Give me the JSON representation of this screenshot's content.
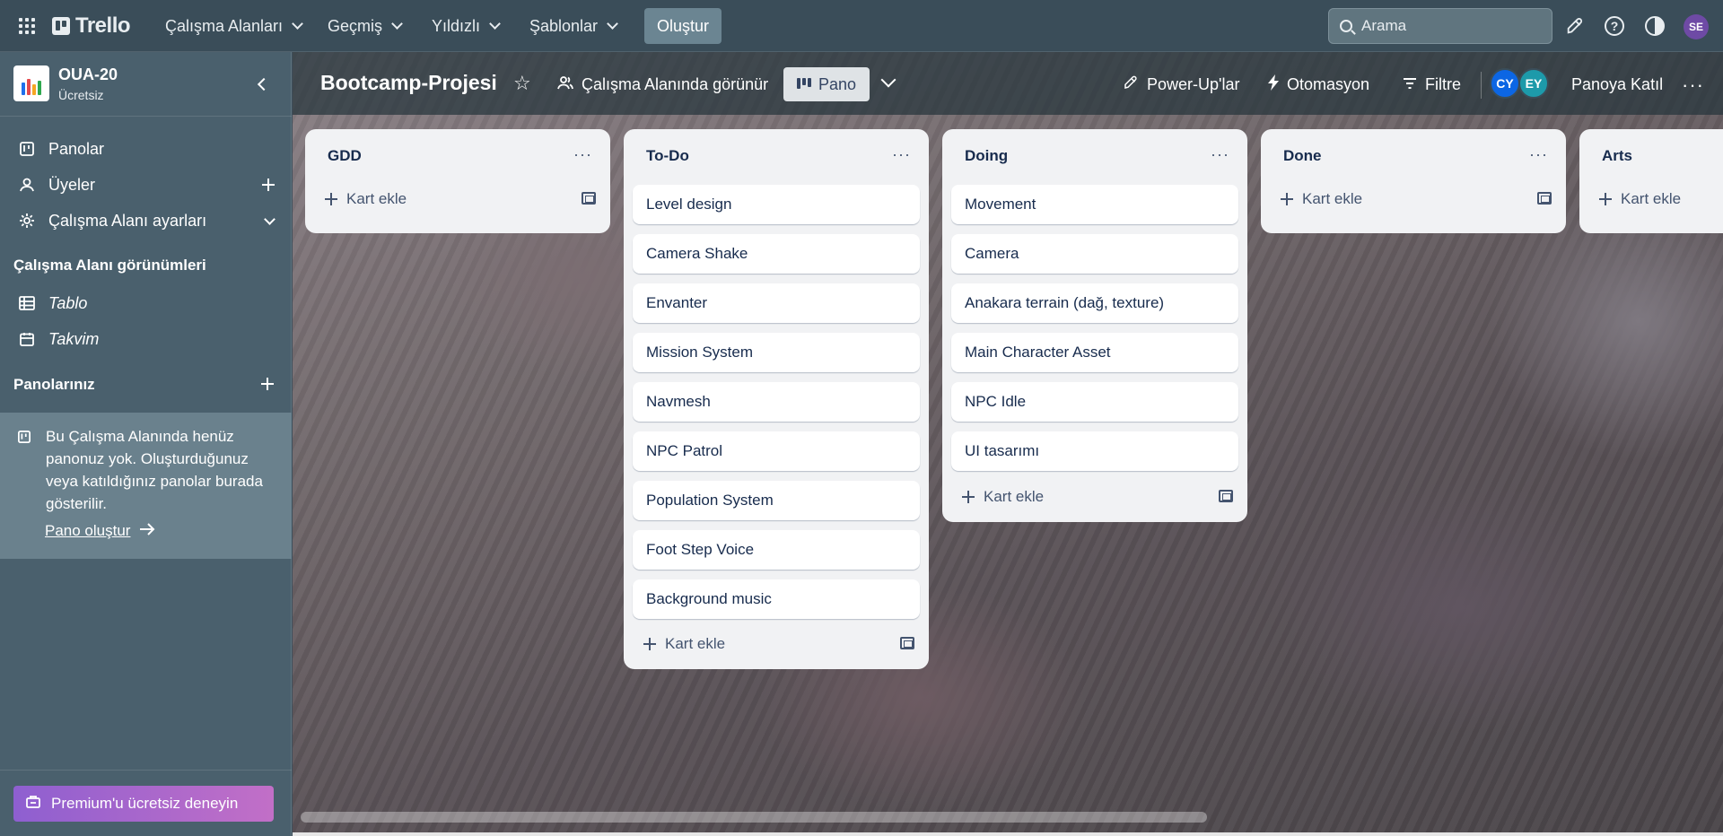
{
  "topbar": {
    "logo": "Trello",
    "menus": [
      "Çalışma Alanları",
      "Geçmiş",
      "Yıldızlı",
      "Şablonlar"
    ],
    "create_label": "Oluştur",
    "search_placeholder": "Arama",
    "user_initials": "SE",
    "user_color": "#6e4aa5"
  },
  "sidebar": {
    "workspace_name": "OUA-20",
    "workspace_plan": "Ücretsiz",
    "items": [
      {
        "label": "Panolar",
        "icon": "board-icon"
      },
      {
        "label": "Üyeler",
        "icon": "person-icon"
      },
      {
        "label": "Çalışma Alanı ayarları",
        "icon": "gear-icon"
      }
    ],
    "views_title": "Çalışma Alanı görünümleri",
    "views": [
      {
        "label": "Tablo",
        "icon": "table-icon"
      },
      {
        "label": "Takvim",
        "icon": "calendar-icon"
      }
    ],
    "boards_title": "Panolarınız",
    "empty_text": "Bu Çalışma Alanında henüz panonuz yok. Oluşturduğunuz veya katıldığınız panolar burada gösterilir.",
    "create_board_link": "Pano oluştur",
    "premium_label": "Premium'u ücretsiz deneyin"
  },
  "board": {
    "title": "Bootcamp-Projesi",
    "visibility": "Çalışma Alanında görünür",
    "view_label": "Pano",
    "powerups": "Power-Up'lar",
    "automation": "Otomasyon",
    "filter": "Filtre",
    "members": [
      {
        "initials": "CY",
        "color": "#0c66e4"
      },
      {
        "initials": "EY",
        "color": "#1d9aaa"
      }
    ],
    "join_label": "Panoya Katıl",
    "add_card_label": "Kart ekle",
    "lists": [
      {
        "title": "GDD",
        "cards": []
      },
      {
        "title": "To-Do",
        "cards": [
          "Level design",
          "Camera Shake",
          "Envanter",
          "Mission System",
          "Navmesh",
          "NPC Patrol",
          "Population System",
          "Foot Step Voice",
          "Background music"
        ]
      },
      {
        "title": "Doing",
        "cards": [
          "Movement",
          "Camera",
          "Anakara terrain (dağ, texture)",
          "Main Character Asset",
          "NPC Idle",
          "UI tasarımı"
        ]
      },
      {
        "title": "Done",
        "cards": []
      },
      {
        "title": "Arts",
        "cards": []
      }
    ]
  }
}
